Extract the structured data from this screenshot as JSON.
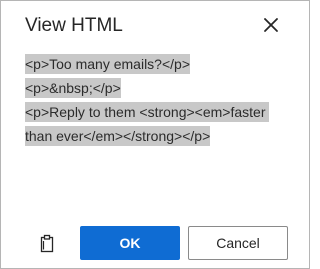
{
  "dialog": {
    "title": "View HTML",
    "close_icon": "close-icon",
    "html_lines": [
      "<p>Too many emails?</p>",
      "<p>&nbsp;</p>",
      "<p>Reply to them <strong><em>faster than ever</em></strong></p>"
    ],
    "copy_icon": "clipboard-icon",
    "ok_label": "OK",
    "cancel_label": "Cancel"
  },
  "colors": {
    "primary": "#0f6cd3",
    "selection_highlight": "#c8c8c8",
    "text": "#262626"
  }
}
